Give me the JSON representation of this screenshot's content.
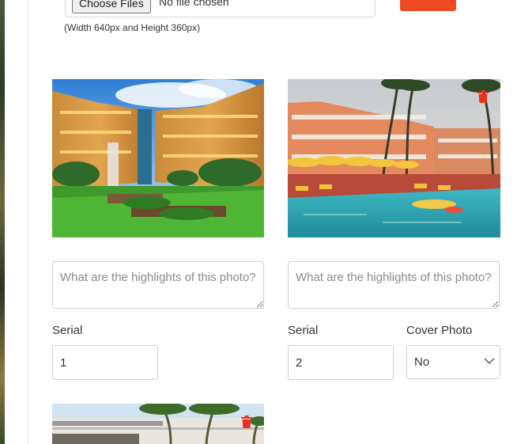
{
  "upload": {
    "choose_label": "Choose Files",
    "no_file_label": "No file chosen",
    "size_hint": "(Width 640px and Height 360px)",
    "upload_button_color": "#f04a24"
  },
  "photos": [
    {
      "image": "hotel-courtyard-fountain",
      "caption_placeholder": "What are the highlights of this photo?",
      "serial_label": "Serial",
      "serial_value": "1"
    },
    {
      "image": "hotel-pool-palms",
      "caption_placeholder": "What are the highlights of this photo?",
      "serial_label": "Serial",
      "serial_value": "2",
      "cover_label": "Cover Photo",
      "cover_value": "No",
      "delete_icon": "trash-icon"
    },
    {
      "image": "hotel-building-palms",
      "delete_icon": "trash-icon"
    }
  ],
  "colors": {
    "delete": "#e8321e",
    "border": "#cfcfcf"
  }
}
